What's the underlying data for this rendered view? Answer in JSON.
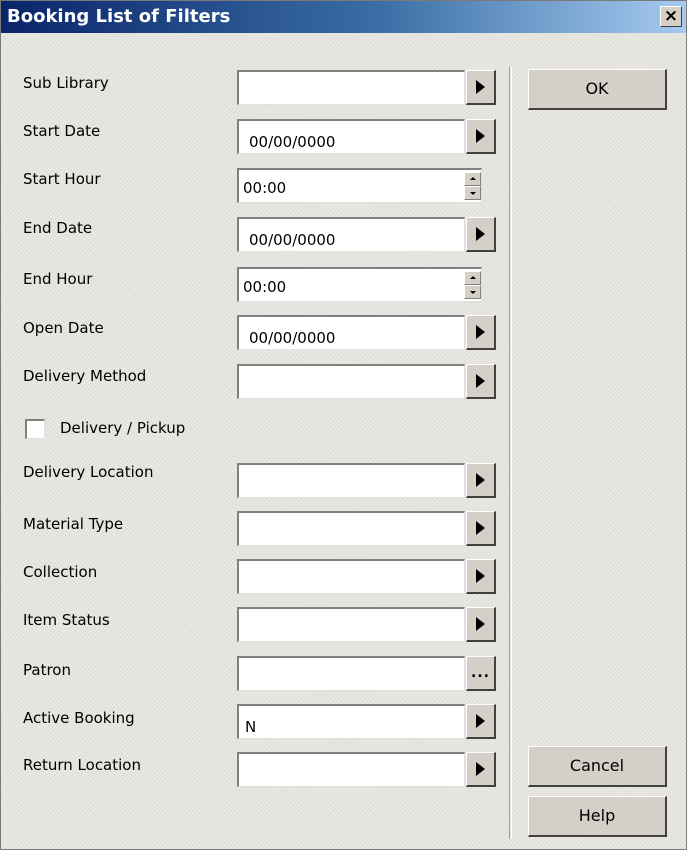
{
  "window": {
    "title": "Booking List of Filters",
    "close_label": "×"
  },
  "fields": {
    "sub_library": {
      "label": "Sub Library",
      "value": ""
    },
    "start_date": {
      "label": "Start Date",
      "value": "00/00/0000"
    },
    "start_hour": {
      "label": "Start Hour",
      "value": "00:00"
    },
    "end_date": {
      "label": "End Date",
      "value": "00/00/0000"
    },
    "end_hour": {
      "label": "End Hour",
      "value": "00:00"
    },
    "open_date": {
      "label": "Open Date",
      "value": "00/00/0000"
    },
    "delivery_method": {
      "label": "Delivery Method",
      "value": ""
    },
    "delivery_pickup": {
      "label": "Delivery / Pickup",
      "checked": false
    },
    "delivery_location": {
      "label": "Delivery Location",
      "value": ""
    },
    "material_type": {
      "label": "Material Type",
      "value": ""
    },
    "collection": {
      "label": "Collection",
      "value": ""
    },
    "item_status": {
      "label": "Item Status",
      "value": ""
    },
    "patron": {
      "label": "Patron",
      "value": "",
      "button_label": "..."
    },
    "active_booking": {
      "label": "Active Booking",
      "value": "N"
    },
    "return_location": {
      "label": "Return Location",
      "value": ""
    }
  },
  "buttons": {
    "ok": "OK",
    "cancel": "Cancel",
    "help": "Help"
  },
  "icons": {
    "dropdown": "triangle-right-icon",
    "spinner": "spin-up-down-icon",
    "lookup": "ellipsis-icon"
  },
  "colors": {
    "titlebar_start": "#0a246a",
    "titlebar_end": "#a6caf0",
    "dialog_bg": "#ebe9e4"
  }
}
